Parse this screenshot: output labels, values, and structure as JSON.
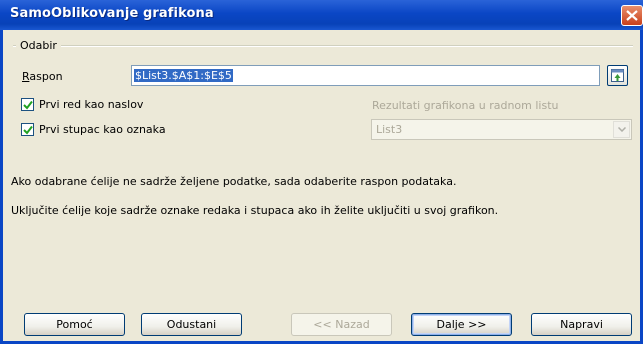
{
  "window": {
    "title": "SamoOblikovanje grafikona"
  },
  "group": {
    "label": "Odabir"
  },
  "range": {
    "label": "Raspon",
    "value": "$List3.$A$1:$E$5"
  },
  "options": {
    "first_row_label": "Prvi red kao naslov",
    "first_col_label": "Prvi stupac kao oznaka",
    "first_row_checked": true,
    "first_col_checked": true
  },
  "results": {
    "label": "Rezultati grafikona u radnom listu",
    "selected": "List3"
  },
  "info": {
    "line1": "Ako odabrane ćelije ne sadrže željene podatke, sada odaberite raspon podataka.",
    "line2": "Uključite ćelije koje sadrže oznake redaka i stupaca ako ih želite uključiti u svoj grafikon."
  },
  "buttons": {
    "help": "Pomoć",
    "cancel": "Odustani",
    "back": "<< Nazad",
    "next": "Dalje >>",
    "finish": "Napravi"
  },
  "colors": {
    "titlebar": "#0a46c5",
    "selection": "#316ac5",
    "dialog_bg": "#ece9d8"
  }
}
